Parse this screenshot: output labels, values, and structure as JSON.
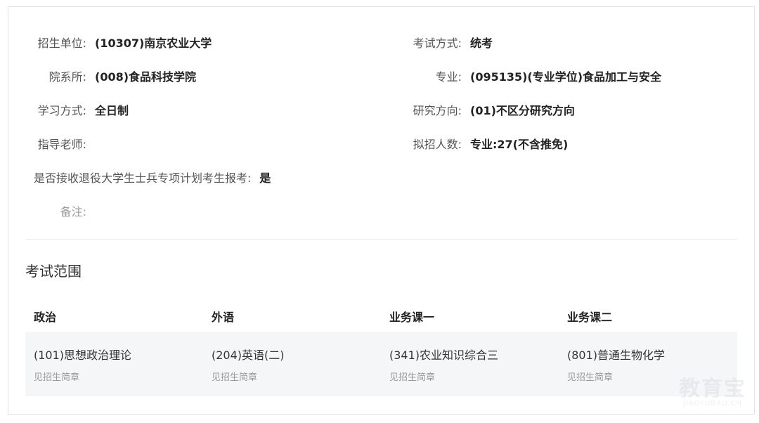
{
  "info": {
    "school_label": "招生单位:",
    "school_value": "(10307)南京农业大学",
    "exam_mode_label": "考试方式:",
    "exam_mode_value": "统考",
    "dept_label": "院系所:",
    "dept_value": "(008)食品科技学院",
    "major_label": "专业:",
    "major_value": "(095135)(专业学位)食品加工与安全",
    "study_mode_label": "学习方式:",
    "study_mode_value": "全日制",
    "direction_label": "研究方向:",
    "direction_value": "(01)不区分研究方向",
    "advisor_label": "指导老师:",
    "advisor_value": "",
    "quota_label": "拟招人数:",
    "quota_value": "专业:27(不含推免)",
    "veteran_label": "是否接收退役大学生士兵专项计划考生报考:",
    "veteran_value": "是",
    "remark_label": "备注:",
    "remark_value": ""
  },
  "exam_scope": {
    "title": "考试范围",
    "headers": [
      "政治",
      "外语",
      "业务课一",
      "业务课二"
    ],
    "courses": [
      {
        "name": "(101)思想政治理论",
        "note": "见招生简章"
      },
      {
        "name": "(204)英语(二)",
        "note": "见招生简章"
      },
      {
        "name": "(341)农业知识综合三",
        "note": "见招生简章"
      },
      {
        "name": "(801)普通生物化学",
        "note": "见招生简章"
      }
    ]
  },
  "watermark": {
    "main": "教育宝",
    "sub": "JIAOYUBAO.CN"
  }
}
